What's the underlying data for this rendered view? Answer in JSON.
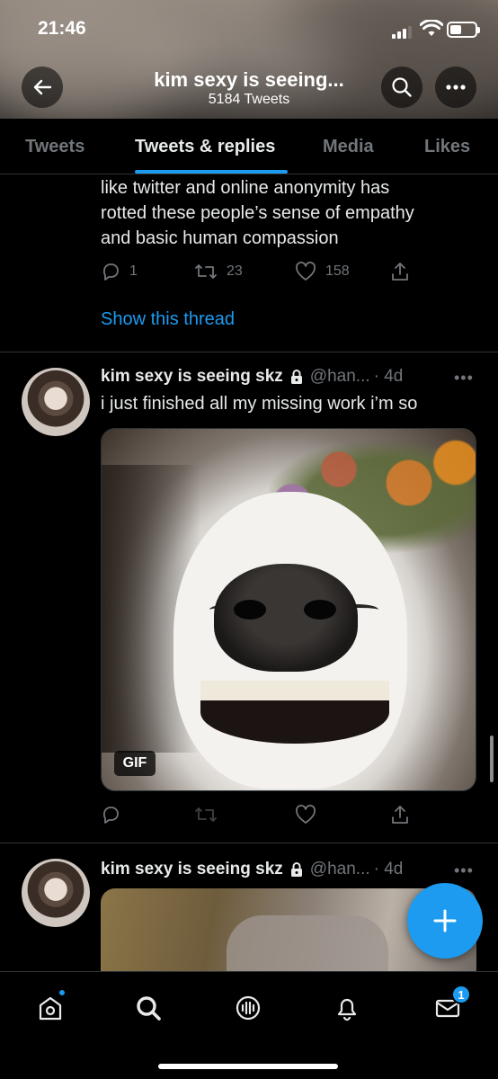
{
  "status": {
    "time": "21:46",
    "battery_level": 0.45
  },
  "header": {
    "title": "kim sexy is seeing...",
    "subtitle": "5184 Tweets",
    "icons": {
      "back": "back-arrow-icon",
      "search": "search-icon",
      "more": "more-horizontal-icon"
    }
  },
  "tabs": [
    {
      "label": "Tweets"
    },
    {
      "label": "Tweets & replies",
      "active": true
    },
    {
      "label": "Media"
    },
    {
      "label": "Likes"
    }
  ],
  "prev_tweet": {
    "lines": [
      "like twitter and online anonymity has",
      "rotted these people’s sense of empathy",
      "and basic human compassion"
    ],
    "replies": "1",
    "retweets": "23",
    "likes": "158",
    "show_thread": "Show this thread"
  },
  "tweet1": {
    "name": "kim sexy is seeing skz",
    "handle": "@han...",
    "time": "· 4d",
    "text": "i just finished all my missing work i’m so",
    "media_badge": "GIF",
    "more": "•••"
  },
  "tweet2": {
    "name": "kim sexy is seeing skz",
    "handle": "@han...",
    "time": "· 4d",
    "more": "•••"
  },
  "fab_icon": "compose-plus-icon",
  "bottom_nav": {
    "items": [
      "home-icon",
      "search-icon",
      "spaces-icon",
      "notifications-bell-icon",
      "messages-icon"
    ],
    "messages_badge": "1"
  },
  "colors": {
    "accent": "#1d9bf0",
    "background": "#000000",
    "muted": "#71767b"
  }
}
